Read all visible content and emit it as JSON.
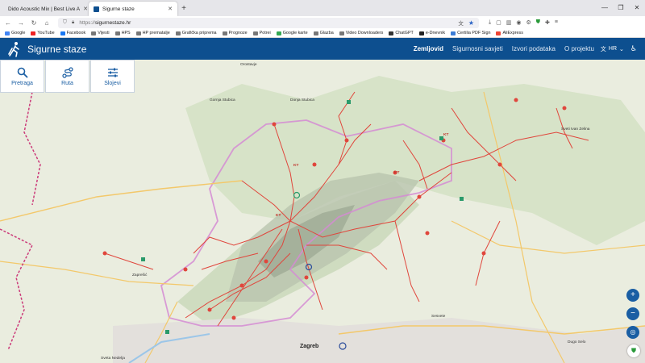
{
  "browser": {
    "tabs": [
      {
        "label": "Dido Acoustic Mix | Best Live A",
        "icon": "youtube-icon"
      },
      {
        "label": "Sigurne staze",
        "icon": "hiker-icon"
      }
    ],
    "url": {
      "scheme": "https://",
      "host": "sigurnestaze.hr"
    },
    "bookmarks": [
      "Google",
      "YouTube",
      "Facebook",
      "Vijesti",
      "HPS",
      "HP prematalje",
      "Grafička priprema",
      "Prognoze",
      "Potrei",
      "Google karte",
      "Glazba",
      "Video Downloaders",
      "ChatGPT",
      "e-Dnevnik",
      "Certilia PDF Sign",
      "AliExpress"
    ]
  },
  "app": {
    "title": "Sigurne staze",
    "menu": [
      "Zemljovid",
      "Sigurnosni savjeti",
      "Izvori podataka",
      "O projektu"
    ],
    "active_menu": "Zemljovid",
    "language": "HR",
    "brand_color": "#0d4f8f"
  },
  "toolbar": {
    "search_label": "Pretraga",
    "route_label": "Ruta",
    "layers_label": "Slojevi"
  },
  "map": {
    "zoom_in": "+",
    "zoom_out": "−",
    "labels": {
      "orostavje": "Orostavje",
      "donja_stubica": "Donja Stubica",
      "gornja_stubica": "Gornja Stubica",
      "sveti_ivan_zelina": "Sveti Ivan Zelina",
      "zapresic": "Zaprešić",
      "zagreb": "Zagreb",
      "dugo_selo": "Dugo Selo",
      "sesvete": "Sesvete",
      "sveta_nedelja": "Sveta Nedelja",
      "kt1": "KT",
      "kt2": "KT",
      "kt3": "KT",
      "kt4": "KT"
    }
  }
}
